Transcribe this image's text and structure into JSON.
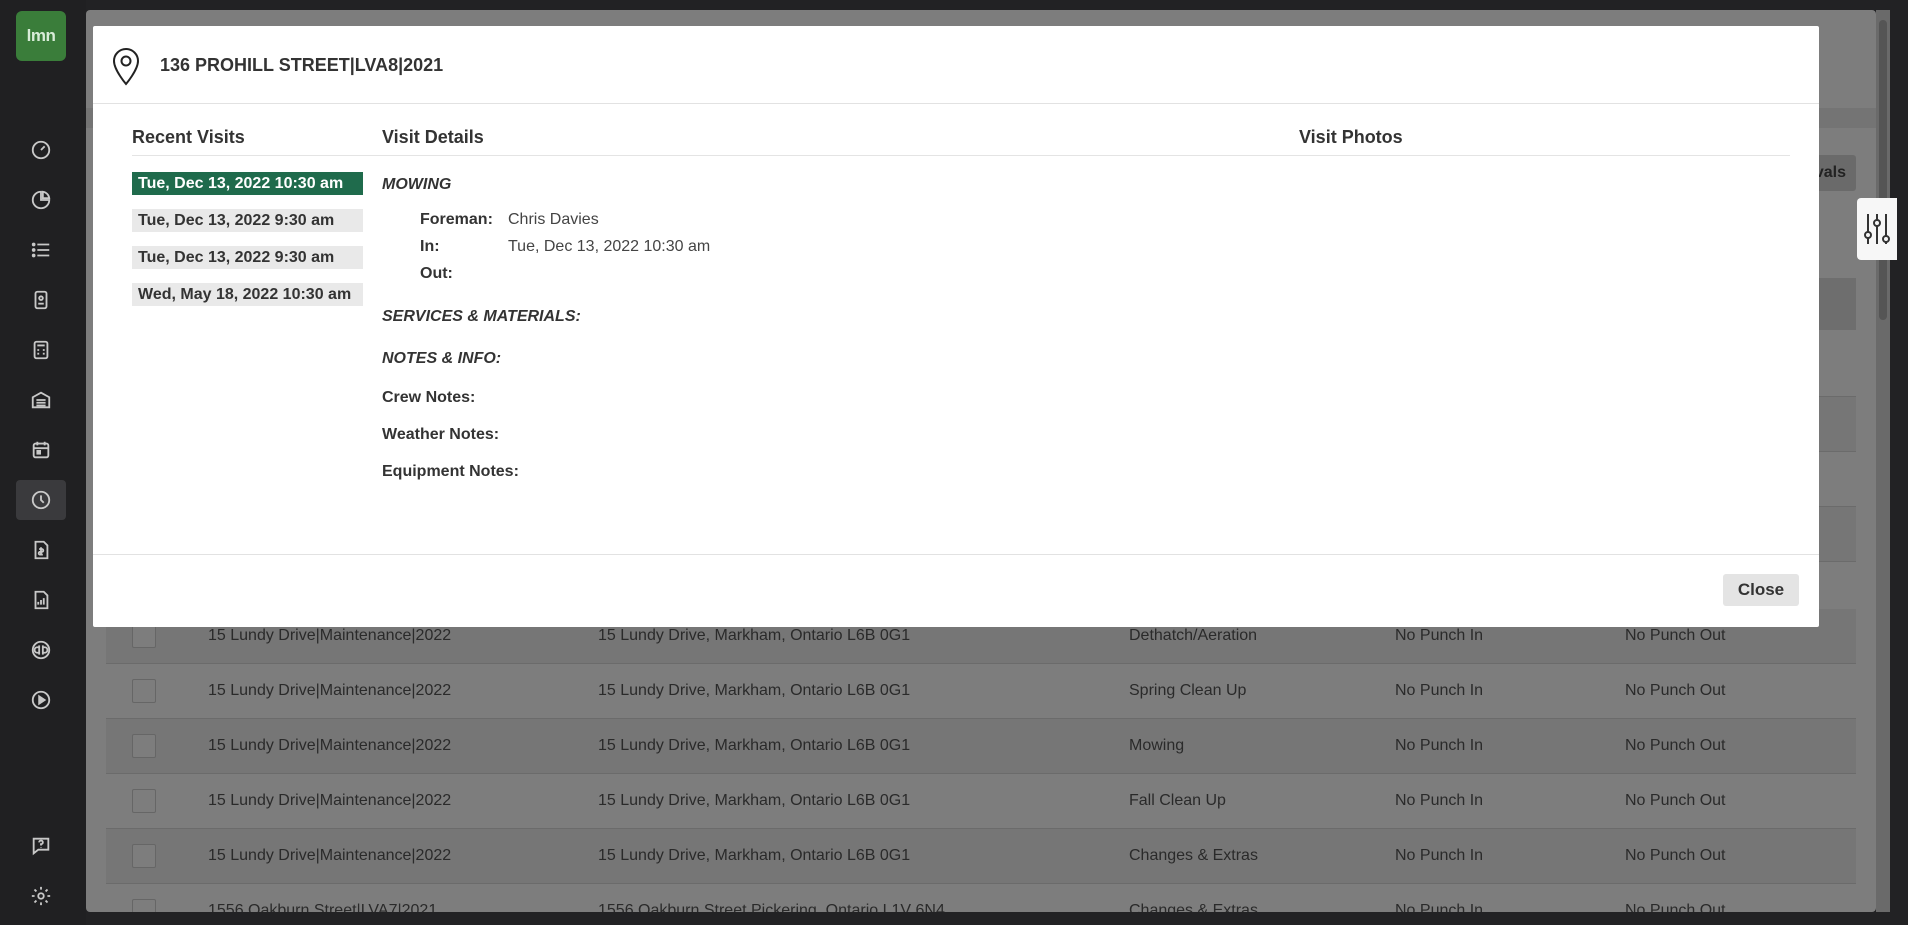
{
  "nav": {
    "logo_text": "lmn",
    "icons": [
      "dashboard-icon",
      "pie-chart-icon",
      "list-icon",
      "clipboard-icon",
      "calculator-icon",
      "warehouse-icon",
      "calendar-icon",
      "clock-icon",
      "invoice-icon",
      "report-icon",
      "quickbooks-icon",
      "play-icon",
      "help-icon",
      "gear-icon"
    ],
    "active_icon": "clock-icon"
  },
  "background": {
    "button_label": "rvals",
    "rows": [
      {
        "job": "15 Lundy Drive|Maintenance|2022",
        "address": "15 Lundy Drive, Markham, Ontario L6B 0G1",
        "service": "Dethatch/Aeration",
        "punch_in": "No Punch In",
        "punch_out": "No Punch Out"
      },
      {
        "job": "15 Lundy Drive|Maintenance|2022",
        "address": "15 Lundy Drive, Markham, Ontario L6B 0G1",
        "service": "Spring Clean Up",
        "punch_in": "No Punch In",
        "punch_out": "No Punch Out"
      },
      {
        "job": "15 Lundy Drive|Maintenance|2022",
        "address": "15 Lundy Drive, Markham, Ontario L6B 0G1",
        "service": "Mowing",
        "punch_in": "No Punch In",
        "punch_out": "No Punch Out"
      },
      {
        "job": "15 Lundy Drive|Maintenance|2022",
        "address": "15 Lundy Drive, Markham, Ontario L6B 0G1",
        "service": "Fall Clean Up",
        "punch_in": "No Punch In",
        "punch_out": "No Punch Out"
      },
      {
        "job": "15 Lundy Drive|Maintenance|2022",
        "address": "15 Lundy Drive, Markham, Ontario L6B 0G1",
        "service": "Changes & Extras",
        "punch_in": "No Punch In",
        "punch_out": "No Punch Out"
      },
      {
        "job": "1556 Oakburn Street|LVA7|2021",
        "address": "1556 Oakburn Street Pickering, Ontario L1V 6N4",
        "service": "Changes & Extras",
        "punch_in": "No Punch In",
        "punch_out": "No Punch Out"
      }
    ]
  },
  "modal": {
    "title": "136 PROHILL STREET|LVA8|2021",
    "recent_visits_title": "Recent Visits",
    "visit_details_title": "Visit Details",
    "visit_photos_title": "Visit Photos",
    "visits": [
      {
        "label": "Tue, Dec 13, 2022 10:30 am",
        "selected": true
      },
      {
        "label": "Tue, Dec 13, 2022 9:30 am",
        "selected": false
      },
      {
        "label": "Tue, Dec 13, 2022 9:30 am",
        "selected": false
      },
      {
        "label": "Wed, May 18, 2022 10:30 am",
        "selected": false
      }
    ],
    "service_name": "MOWING",
    "foreman_label": "Foreman:",
    "foreman_value": "Chris Davies",
    "in_label": "In:",
    "in_value": "Tue, Dec 13, 2022 10:30 am",
    "out_label": "Out:",
    "out_value": "",
    "services_label": "SERVICES & MATERIALS:",
    "notes_label": "NOTES & INFO:",
    "crew_notes_label": "Crew Notes:",
    "weather_notes_label": "Weather Notes:",
    "equipment_notes_label": "Equipment Notes:",
    "close_label": "Close"
  },
  "colors": {
    "selected_visit": "#1f6b4c",
    "logo_green": "#3a7d3a"
  }
}
